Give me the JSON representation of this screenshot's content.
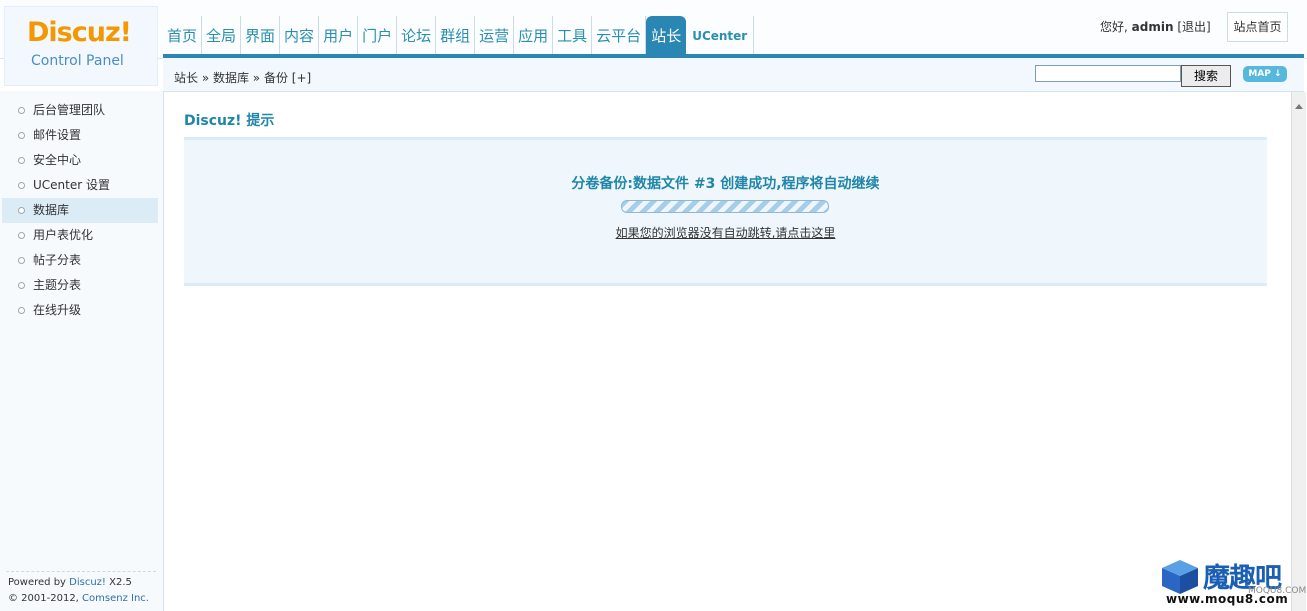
{
  "logo": {
    "brand": "Discuz!",
    "subtitle": "Control Panel"
  },
  "nav": {
    "items": [
      {
        "label": "首页"
      },
      {
        "label": "全局"
      },
      {
        "label": "界面"
      },
      {
        "label": "内容"
      },
      {
        "label": "用户"
      },
      {
        "label": "门户"
      },
      {
        "label": "论坛"
      },
      {
        "label": "群组"
      },
      {
        "label": "运营"
      },
      {
        "label": "应用"
      },
      {
        "label": "工具"
      },
      {
        "label": "云平台"
      },
      {
        "label": "站长",
        "active": true
      },
      {
        "label": "UCenter"
      }
    ]
  },
  "header": {
    "greeting": "您好,",
    "username": "admin",
    "logout": "[退出]",
    "site_home": "站点首页"
  },
  "breadcrumb": "站长 » 数据库 » 备份 [+]",
  "search": {
    "value": "",
    "button": "搜索"
  },
  "map_button": "MAP ↓",
  "sidebar": {
    "items": [
      {
        "label": "后台管理团队"
      },
      {
        "label": "邮件设置"
      },
      {
        "label": "安全中心"
      },
      {
        "label": "UCenter 设置"
      },
      {
        "label": "数据库",
        "active": true
      },
      {
        "label": "用户表优化"
      },
      {
        "label": "帖子分表"
      },
      {
        "label": "主题分表"
      },
      {
        "label": "在线升级"
      }
    ],
    "powered_prefix": "Powered by ",
    "powered_brand": "Discuz!",
    "powered_version": " X2.5",
    "copyright_prefix": "© 2001-2012, ",
    "copyright_company": "Comsenz Inc."
  },
  "notice": {
    "title": "Discuz! 提示",
    "message": "分卷备份:数据文件 #3 创建成功,程序将自动继续",
    "redirect_link": "如果您的浏览器没有自动跳转,请点击这里"
  },
  "watermark": {
    "text": "魔趣吧",
    "small": "MOQU8.COM",
    "url": "www.moqu8.com"
  }
}
